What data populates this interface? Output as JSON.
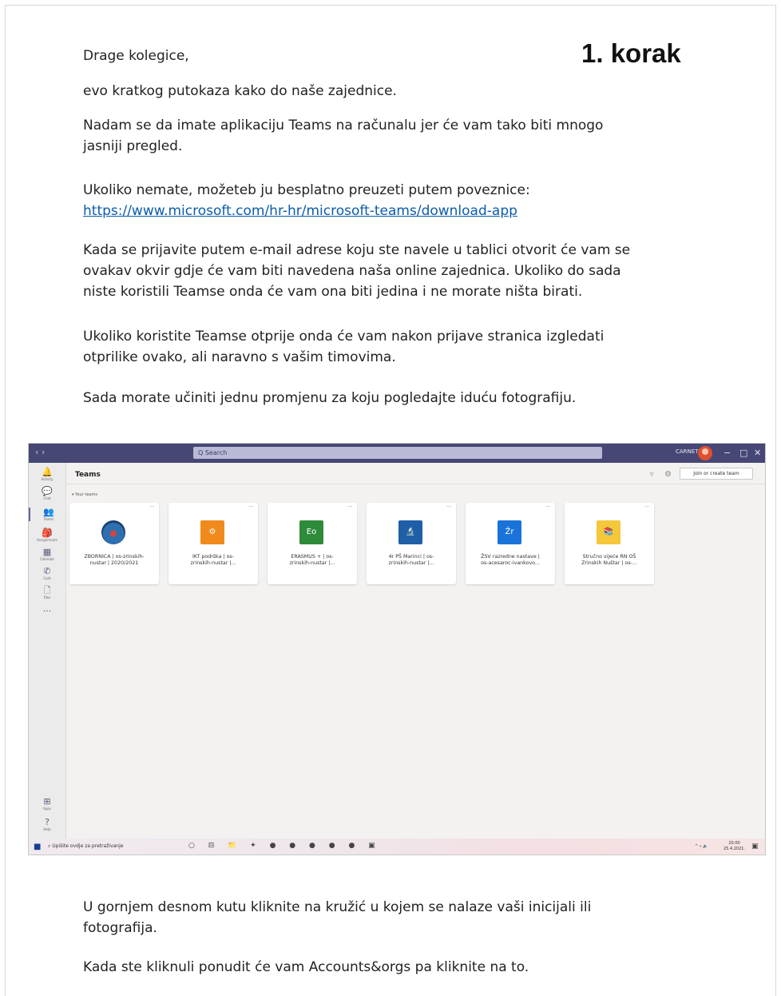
{
  "heading": {
    "step": "1. korak"
  },
  "intro": {
    "greeting": "Drage kolegice,",
    "p1": "evo kratkog putokaza kako do naše zajednice.",
    "p2_line1": "Nadam se da imate aplikaciju Teams na računalu jer će vam tako biti mnogo",
    "p2_line2": "jasniji pregled.",
    "p3_line1": "Ukoliko nemate, možeteb ju besplatno preuzeti putem poveznice:",
    "p3_link": "https://www.microsoft.com/hr-hr/microsoft-teams/download-app",
    "p4_line1": "Kada se prijavite putem e-mail adrese koju ste navele u tablici otvorit će vam se",
    "p4_line2": "ovakav okvir gdje će vam biti navedena naša online zajednica. Ukoliko do sada",
    "p4_line3": "niste koristili Teamse onda će vam ona biti jedina i ne morate ništa birati.",
    "p5_line1": "Ukoliko koristite Teamse otprije onda će vam nakon prijave stranica izgledati",
    "p5_line2": "otprilike ovako, ali naravno s vašim timovima.",
    "p6": "Sada morate učiniti jednu promjenu za koju pogledajte iduću fotografiju."
  },
  "screenshot": {
    "titlebar": {
      "search_placeholder": "Q Search",
      "user_name": "CARNET",
      "minimize": "−",
      "maximize": "□",
      "close": "✕",
      "color": "#464775"
    },
    "rail": [
      {
        "icon": "bell-icon",
        "glyph": "🔔",
        "label": "Activity"
      },
      {
        "icon": "chat-icon",
        "glyph": "💬",
        "label": "Chat"
      },
      {
        "icon": "teams-icon",
        "glyph": "👥",
        "label": "Teams"
      },
      {
        "icon": "assignments-icon",
        "glyph": "🎒",
        "label": "Assignments"
      },
      {
        "icon": "calendar-icon",
        "glyph": "▦",
        "label": "Calendar"
      },
      {
        "icon": "calls-icon",
        "glyph": "✆",
        "label": "Calls"
      },
      {
        "icon": "files-icon",
        "glyph": "🗋",
        "label": "Files"
      },
      {
        "icon": "more-icon",
        "glyph": "···",
        "label": ""
      },
      {
        "icon": "apps-icon",
        "glyph": "⊞",
        "label": "Apps"
      },
      {
        "icon": "help-icon",
        "glyph": "?",
        "label": "Help"
      }
    ],
    "main": {
      "title": "Teams",
      "join_button": "Join or create team",
      "section_label": "▾ Your teams"
    },
    "teams": [
      {
        "name_line1": "ZBORNICA | os-zrinskih-",
        "name_line2": "nustar | 2020/2021",
        "logo_color": "#2e6fb0",
        "logo_letter": ""
      },
      {
        "name_line1": "IKT podrška | os-",
        "name_line2": "zrinskih-nustar |...",
        "logo_color": "#f08a1c",
        "logo_letter": "⚙"
      },
      {
        "name_line1": "ERASMUS + | os-",
        "name_line2": "zrinskih-nustar |...",
        "logo_color": "#2e8b3a",
        "logo_letter": "Eo"
      },
      {
        "name_line1": "4r PŠ Marinci | os-",
        "name_line2": "zrinskih-nustar |...",
        "logo_color": "#1f5fa8",
        "logo_letter": "🔬"
      },
      {
        "name_line1": "ŽSV razredne nastave |",
        "name_line2": "os-acesaroc-ivankovo...",
        "logo_color": "#1a73d9",
        "logo_letter": "Žr"
      },
      {
        "name_line1": "Stručno vijeće RN OŠ",
        "name_line2": "Zrinskih Nuštar | os-...",
        "logo_color": "#f5c73b",
        "logo_letter": "📚"
      }
    ],
    "taskbar": {
      "search_text": "Upišite ovdje za pretraživanje",
      "apps": "○ ⊟ 📁 ✦ ● ● ● ● ● ▣",
      "tray": "^ ⌁ 🔈",
      "time": "20:00",
      "date": "25.4.2021."
    }
  },
  "outro": {
    "p1_line1": "U gornjem desnom kutu kliknite na kružić u kojem se nalaze vaši inicijali ili",
    "p1_line2": "fotografija.",
    "p2": "Kada ste kliknuli ponudit će vam Accounts&orgs pa kliknite na to."
  }
}
